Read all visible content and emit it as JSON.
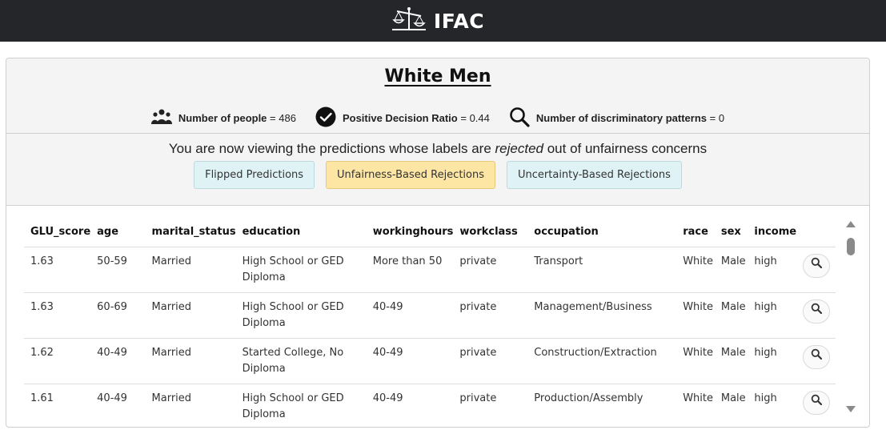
{
  "app": {
    "title": "IFAC",
    "logo_icon": "scales-of-justice-icon"
  },
  "group": {
    "title": "White Men"
  },
  "stats": [
    {
      "icon": "people-group-icon",
      "label": "Number of people",
      "separator": "=",
      "value": "486"
    },
    {
      "icon": "check-circle-icon",
      "label": "Positive Decision Ratio",
      "separator": "=",
      "value": "0.44"
    },
    {
      "icon": "magnifier-icon",
      "label": "Number of discriminatory patterns",
      "separator": "=",
      "value": "0"
    }
  ],
  "viewing": {
    "prefix": "You are now viewing the predictions whose labels are ",
    "emphasis": "rejected",
    "suffix": " out of unfairness concerns"
  },
  "tabs": [
    {
      "label": "Flipped Predictions",
      "active": false
    },
    {
      "label": "Unfairness-Based Rejections",
      "active": true
    },
    {
      "label": "Uncertainty-Based Rejections",
      "active": false
    }
  ],
  "colors": {
    "topbar": "#24262a",
    "tab_default": "#dff3f6",
    "tab_active": "#fde5a4",
    "header_bg": "#f4f4f4"
  },
  "table": {
    "columns": [
      "GLU_score",
      "age",
      "marital_status",
      "education",
      "workinghours",
      "workclass",
      "occupation",
      "race",
      "sex",
      "income"
    ],
    "rows": [
      [
        "1.63",
        "50-59",
        "Married",
        "High School or GED Diploma",
        "More than 50",
        "private",
        "Transport",
        "White",
        "Male",
        "high"
      ],
      [
        "1.63",
        "60-69",
        "Married",
        "High School or GED Diploma",
        "40-49",
        "private",
        "Management/Business",
        "White",
        "Male",
        "high"
      ],
      [
        "1.62",
        "40-49",
        "Married",
        "Started College, No Diploma",
        "40-49",
        "private",
        "Construction/Extraction",
        "White",
        "Male",
        "high"
      ],
      [
        "1.61",
        "40-49",
        "Married",
        "High School or GED Diploma",
        "40-49",
        "private",
        "Production/Assembly",
        "White",
        "Male",
        "high"
      ]
    ],
    "row_action_icon": "magnifier-icon"
  }
}
